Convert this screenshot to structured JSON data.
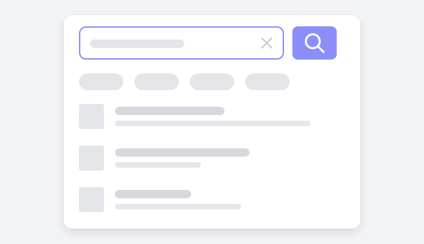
{
  "search": {
    "placeholder": "",
    "value": ""
  },
  "icons": {
    "clear": "close-icon",
    "search": "search-icon"
  },
  "colors": {
    "accent": "#8b8ef8",
    "field_border": "#8b90f6",
    "skeleton": "#e4e5e9",
    "skeleton_dark": "#d6d8de",
    "background": "#f2f3f5",
    "card": "#ffffff"
  },
  "filter_chips": [
    "",
    "",
    "",
    ""
  ],
  "results": [
    {
      "title": "",
      "subtitle": ""
    },
    {
      "title": "",
      "subtitle": ""
    },
    {
      "title": "",
      "subtitle": ""
    }
  ]
}
